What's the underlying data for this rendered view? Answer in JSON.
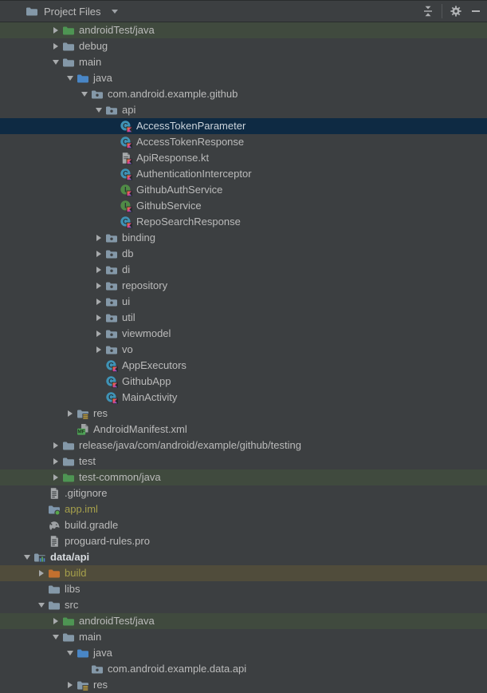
{
  "header": {
    "title": "Project Files",
    "icons": {
      "left": "folder-icon",
      "title_chevron": "chevron-down-icon",
      "right": [
        "collapse-all-icon",
        "gear-icon",
        "hide-icon"
      ]
    }
  },
  "colors": {
    "panel_bg": "#3C3F41",
    "header_border": "#292C2D",
    "text": "#BBBBBB",
    "selected_row_bg": "#0E2A43",
    "selected_text": "#CDD5DC",
    "test_row_bg": "#404A3E",
    "excluded_row_bg": "#504C3B",
    "excluded_text": "#A6A04B",
    "module_text": "#D8DCE0",
    "arrow": "#A7AAAC",
    "folder_gray": "#8498A8",
    "folder_green": "#4E9553",
    "folder_blue": "#4986C6",
    "folder_orange": "#C2702F",
    "iml_folder": "#7E96AC",
    "class_circle": "#3F93B6",
    "interface_circle": "#508B46",
    "manifest_green": "#4FA457",
    "res_lines_yellow": "#C9A53F",
    "file_gray": "#A4A7A9",
    "icon_gray": "#9DA0A3",
    "module_bar_blue": "#4E86C9",
    "module_bar_green": "#59A869",
    "iml_dot_green": "#57A64A",
    "kotlin_gradient": [
      "#F28B1D",
      "#D9418C",
      "#4A6EE0"
    ]
  },
  "tree": {
    "rows": [
      {
        "label": "androidTest/java",
        "level": 3,
        "arrow": "collapsed",
        "icon": "folder-green",
        "row_style": "test",
        "text_style": "normal"
      },
      {
        "label": "debug",
        "level": 3,
        "arrow": "collapsed",
        "icon": "folder",
        "row_style": "",
        "text_style": "normal"
      },
      {
        "label": "main",
        "level": 3,
        "arrow": "expanded",
        "icon": "folder",
        "row_style": "",
        "text_style": "normal"
      },
      {
        "label": "java",
        "level": 4,
        "arrow": "expanded",
        "icon": "folder-blue",
        "row_style": "",
        "text_style": "normal"
      },
      {
        "label": "com.android.example.github",
        "level": 5,
        "arrow": "expanded",
        "icon": "package",
        "row_style": "",
        "text_style": "normal"
      },
      {
        "label": "api",
        "level": 6,
        "arrow": "expanded",
        "icon": "package",
        "row_style": "",
        "text_style": "normal"
      },
      {
        "label": "AccessTokenParameter",
        "level": 7,
        "arrow": "none",
        "icon": "kotlin-class",
        "row_style": "selected",
        "text_style": "normal"
      },
      {
        "label": "AccessTokenResponse",
        "level": 7,
        "arrow": "none",
        "icon": "kotlin-class",
        "row_style": "",
        "text_style": "normal"
      },
      {
        "label": "ApiResponse.kt",
        "level": 7,
        "arrow": "none",
        "icon": "kotlin-file",
        "row_style": "",
        "text_style": "normal"
      },
      {
        "label": "AuthenticationInterceptor",
        "level": 7,
        "arrow": "none",
        "icon": "kotlin-class",
        "row_style": "",
        "text_style": "normal"
      },
      {
        "label": "GithubAuthService",
        "level": 7,
        "arrow": "none",
        "icon": "kotlin-interface",
        "row_style": "",
        "text_style": "normal"
      },
      {
        "label": "GithubService",
        "level": 7,
        "arrow": "none",
        "icon": "kotlin-interface",
        "row_style": "",
        "text_style": "normal"
      },
      {
        "label": "RepoSearchResponse",
        "level": 7,
        "arrow": "none",
        "icon": "kotlin-class",
        "row_style": "",
        "text_style": "normal"
      },
      {
        "label": "binding",
        "level": 6,
        "arrow": "collapsed",
        "icon": "package",
        "row_style": "",
        "text_style": "normal"
      },
      {
        "label": "db",
        "level": 6,
        "arrow": "collapsed",
        "icon": "package",
        "row_style": "",
        "text_style": "normal"
      },
      {
        "label": "di",
        "level": 6,
        "arrow": "collapsed",
        "icon": "package",
        "row_style": "",
        "text_style": "normal"
      },
      {
        "label": "repository",
        "level": 6,
        "arrow": "collapsed",
        "icon": "package",
        "row_style": "",
        "text_style": "normal"
      },
      {
        "label": "ui",
        "level": 6,
        "arrow": "collapsed",
        "icon": "package",
        "row_style": "",
        "text_style": "normal"
      },
      {
        "label": "util",
        "level": 6,
        "arrow": "collapsed",
        "icon": "package",
        "row_style": "",
        "text_style": "normal"
      },
      {
        "label": "viewmodel",
        "level": 6,
        "arrow": "collapsed",
        "icon": "package",
        "row_style": "",
        "text_style": "normal"
      },
      {
        "label": "vo",
        "level": 6,
        "arrow": "collapsed",
        "icon": "package",
        "row_style": "",
        "text_style": "normal"
      },
      {
        "label": "AppExecutors",
        "level": 6,
        "arrow": "none",
        "icon": "kotlin-class",
        "row_style": "",
        "text_style": "normal"
      },
      {
        "label": "GithubApp",
        "level": 6,
        "arrow": "none",
        "icon": "kotlin-class",
        "row_style": "",
        "text_style": "normal"
      },
      {
        "label": "MainActivity",
        "level": 6,
        "arrow": "none",
        "icon": "kotlin-class",
        "row_style": "",
        "text_style": "normal"
      },
      {
        "label": "res",
        "level": 4,
        "arrow": "collapsed",
        "icon": "folder-res",
        "row_style": "",
        "text_style": "normal"
      },
      {
        "label": "AndroidManifest.xml",
        "level": 4,
        "arrow": "none",
        "icon": "manifest",
        "row_style": "",
        "text_style": "normal"
      },
      {
        "label": "release/java/com/android/example/github/testing",
        "level": 3,
        "arrow": "collapsed",
        "icon": "folder",
        "row_style": "",
        "text_style": "normal"
      },
      {
        "label": "test",
        "level": 3,
        "arrow": "collapsed",
        "icon": "folder",
        "row_style": "",
        "text_style": "normal"
      },
      {
        "label": "test-common/java",
        "level": 3,
        "arrow": "collapsed",
        "icon": "folder-green",
        "row_style": "test",
        "text_style": "normal"
      },
      {
        "label": ".gitignore",
        "level": 2,
        "arrow": "none",
        "icon": "text-file",
        "row_style": "",
        "text_style": "normal"
      },
      {
        "label": "app.iml",
        "level": 2,
        "arrow": "none",
        "icon": "iml",
        "row_style": "",
        "text_style": "excluded"
      },
      {
        "label": "build.gradle",
        "level": 2,
        "arrow": "none",
        "icon": "gradle",
        "row_style": "",
        "text_style": "normal"
      },
      {
        "label": "proguard-rules.pro",
        "level": 2,
        "arrow": "none",
        "icon": "text-file",
        "row_style": "",
        "text_style": "normal"
      },
      {
        "label": "data/api",
        "level": 1,
        "arrow": "expanded",
        "icon": "module",
        "row_style": "",
        "text_style": "module"
      },
      {
        "label": "build",
        "level": 2,
        "arrow": "collapsed",
        "icon": "folder-orange",
        "row_style": "excluded",
        "text_style": "excluded"
      },
      {
        "label": "libs",
        "level": 2,
        "arrow": "none",
        "icon": "folder",
        "row_style": "",
        "text_style": "normal"
      },
      {
        "label": "src",
        "level": 2,
        "arrow": "expanded",
        "icon": "folder",
        "row_style": "",
        "text_style": "normal"
      },
      {
        "label": "androidTest/java",
        "level": 3,
        "arrow": "collapsed",
        "icon": "folder-green",
        "row_style": "test",
        "text_style": "normal"
      },
      {
        "label": "main",
        "level": 3,
        "arrow": "expanded",
        "icon": "folder",
        "row_style": "",
        "text_style": "normal"
      },
      {
        "label": "java",
        "level": 4,
        "arrow": "expanded",
        "icon": "folder-blue",
        "row_style": "",
        "text_style": "normal"
      },
      {
        "label": "com.android.example.data.api",
        "level": 5,
        "arrow": "none",
        "icon": "package",
        "row_style": "",
        "text_style": "normal"
      },
      {
        "label": "res",
        "level": 4,
        "arrow": "collapsed",
        "icon": "folder-res",
        "row_style": "",
        "text_style": "normal"
      }
    ]
  }
}
